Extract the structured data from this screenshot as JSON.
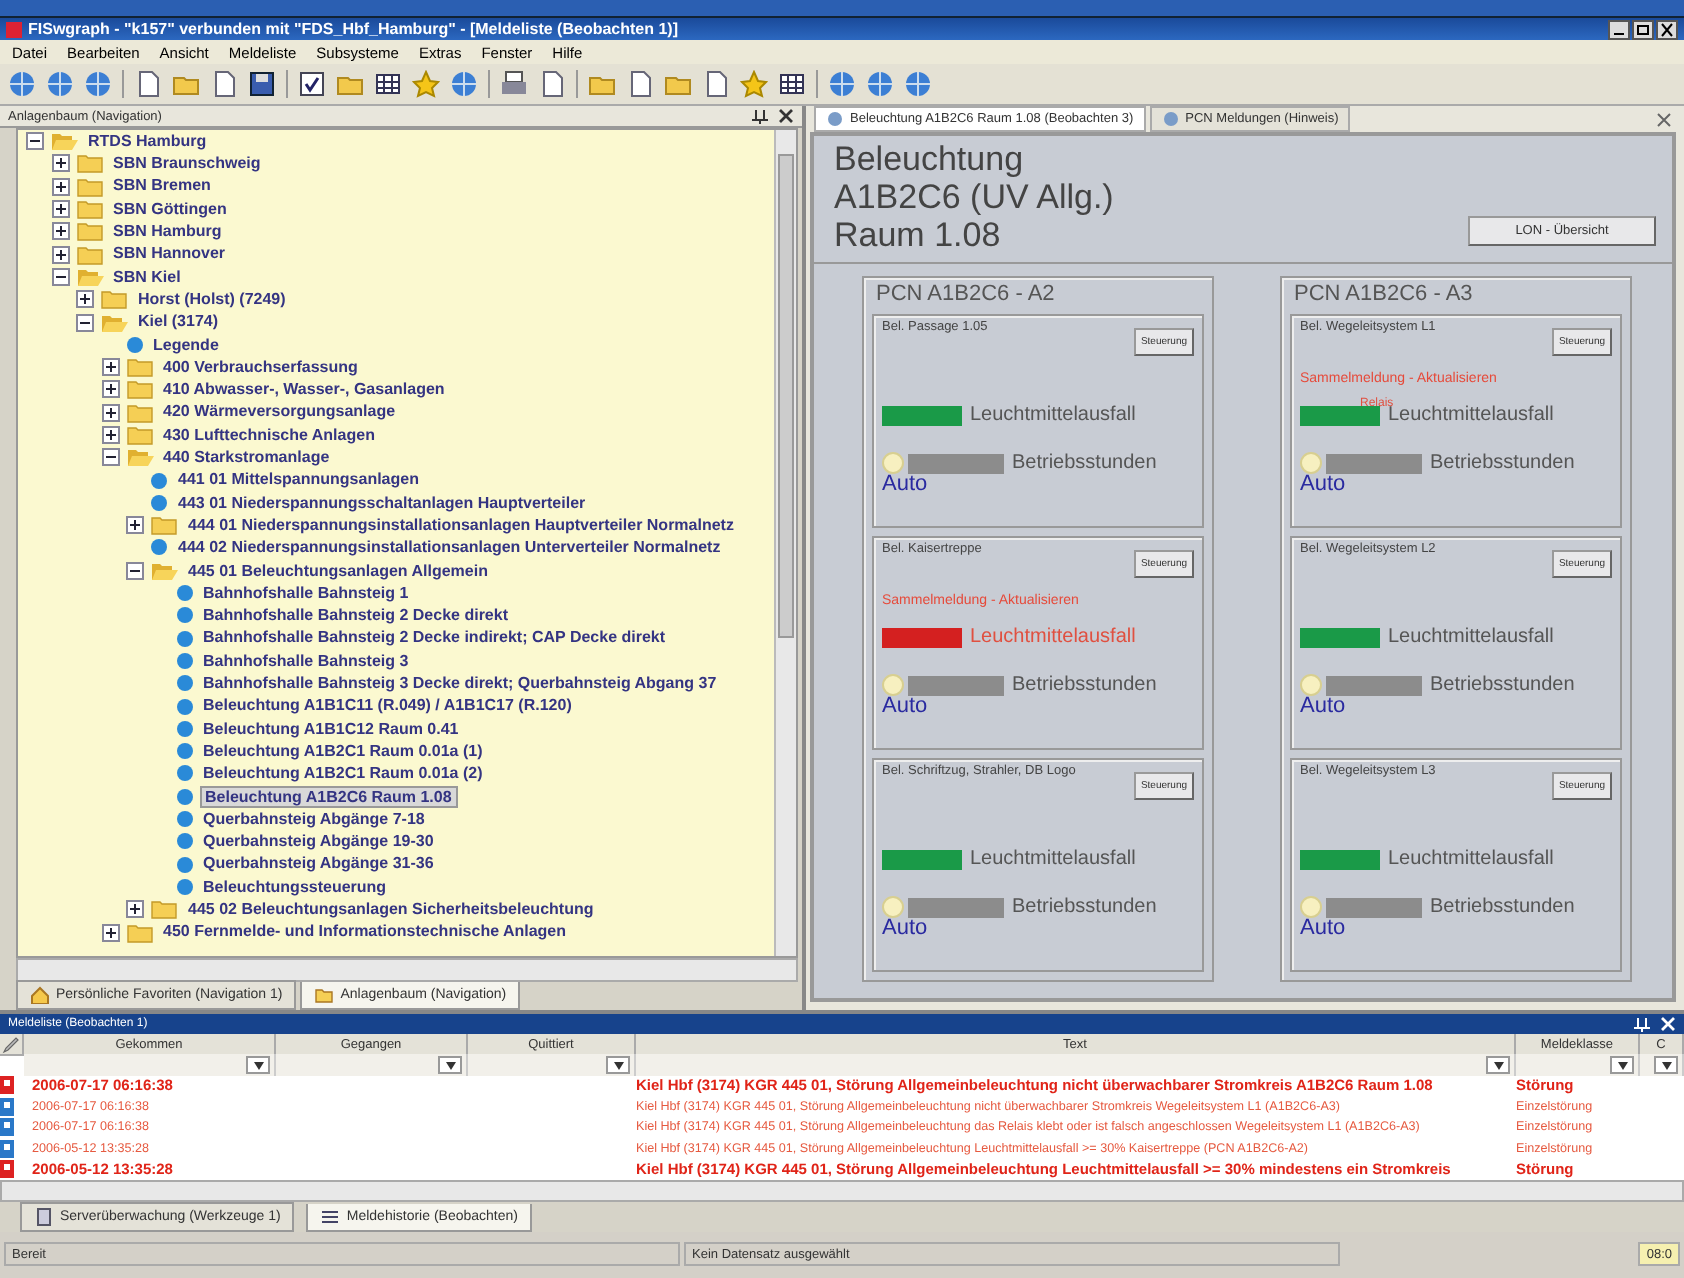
{
  "window": {
    "title": "FISwgraph - \"k157\" verbunden mit \"FDS_Hbf_Hamburg\" - [Meldeliste (Beobachten 1)]"
  },
  "menu": [
    "Datei",
    "Bearbeiten",
    "Ansicht",
    "Meldeliste",
    "Subsysteme",
    "Extras",
    "Fenster",
    "Hilfe"
  ],
  "tree_panel": {
    "title": "Anlagenbaum (Navigation)",
    "tree": [
      {
        "label": "RTDS Hamburg",
        "expanded": true,
        "selected": false,
        "children": [
          {
            "label": "SBN Braunschweig",
            "expanded": false,
            "selected": false
          },
          {
            "label": "SBN Bremen",
            "expanded": false,
            "selected": false
          },
          {
            "label": "SBN Göttingen",
            "expanded": false,
            "selected": false
          },
          {
            "label": "SBN Hamburg",
            "expanded": false,
            "selected": false
          },
          {
            "label": "SBN Hannover",
            "expanded": false,
            "selected": false
          },
          {
            "label": "SBN Kiel",
            "expanded": true,
            "selected": false,
            "children": [
              {
                "label": "Horst (Holst) (7249)",
                "expanded": false,
                "selected": false
              },
              {
                "label": "Kiel (3174)",
                "expanded": true,
                "selected": false,
                "children": [
                  {
                    "label": "Legende",
                    "selected": false
                  },
                  {
                    "label": "400 Verbrauchserfassung",
                    "expanded": false,
                    "selected": false
                  },
                  {
                    "label": "410 Abwasser-, Wasser-, Gasanlagen",
                    "expanded": false,
                    "selected": false
                  },
                  {
                    "label": "420 Wärmeversorgungsanlage",
                    "expanded": false,
                    "selected": false
                  },
                  {
                    "label": "430 Lufttechnische Anlagen",
                    "expanded": false,
                    "selected": false
                  },
                  {
                    "label": "440 Starkstromanlage",
                    "expanded": true,
                    "selected": false,
                    "children": [
                      {
                        "label": "441 01 Mittelspannungsanlagen",
                        "selected": false
                      },
                      {
                        "label": "443 01 Niederspannungsschaltanlagen Hauptverteiler",
                        "selected": false
                      },
                      {
                        "label": "444 01 Niederspannungsinstallationsanlagen Hauptverteiler Normalnetz",
                        "expanded": false,
                        "selected": false
                      },
                      {
                        "label": "444 02 Niederspannungsinstallationsanlagen Unterverteiler Normalnetz",
                        "selected": false
                      },
                      {
                        "label": "445 01 Beleuchtungsanlagen Allgemein",
                        "expanded": true,
                        "selected": false,
                        "children": [
                          {
                            "label": "Bahnhofshalle Bahnsteig 1",
                            "selected": false
                          },
                          {
                            "label": "Bahnhofshalle Bahnsteig 2 Decke direkt",
                            "selected": false
                          },
                          {
                            "label": "Bahnhofshalle Bahnsteig 2 Decke indirekt; CAP Decke direkt",
                            "selected": false
                          },
                          {
                            "label": "Bahnhofshalle Bahnsteig 3",
                            "selected": false
                          },
                          {
                            "label": "Bahnhofshalle Bahnsteig 3 Decke direkt; Querbahnsteig Abgang 37",
                            "selected": false
                          },
                          {
                            "label": "Beleuchtung A1B1C11 (R.049) / A1B1C17 (R.120)",
                            "selected": false
                          },
                          {
                            "label": "Beleuchtung A1B1C12 Raum 0.41",
                            "selected": false
                          },
                          {
                            "label": "Beleuchtung A1B2C1 Raum 0.01a (1)",
                            "selected": false
                          },
                          {
                            "label": "Beleuchtung A1B2C1 Raum 0.01a (2)",
                            "selected": false
                          },
                          {
                            "label": "Beleuchtung A1B2C6 Raum 1.08",
                            "selected": true
                          },
                          {
                            "label": "Querbahnsteig Abgänge  7-18",
                            "selected": false
                          },
                          {
                            "label": "Querbahnsteig Abgänge 19-30",
                            "selected": false
                          },
                          {
                            "label": "Querbahnsteig Abgänge 31-36",
                            "selected": false
                          },
                          {
                            "label": "Beleuchtungssteuerung",
                            "selected": false
                          }
                        ]
                      },
                      {
                        "label": "445 02 Beleuchtungsanlagen Sicherheitsbeleuchtung",
                        "expanded": false,
                        "selected": false
                      }
                    ]
                  },
                  {
                    "label": "450 Fernmelde- und Informationstechnische Anlagen",
                    "expanded": false,
                    "selected": false
                  }
                ]
              }
            ]
          }
        ]
      }
    ],
    "tabs": [
      {
        "label": "Persönliche Favoriten (Navigation 1)",
        "selected": false
      },
      {
        "label": "Anlagenbaum (Navigation)",
        "selected": true
      }
    ]
  },
  "detail_panel": {
    "tabs": [
      {
        "label": "Beleuchtung A1B2C6 Raum 1.08 (Beobachten 3)",
        "selected": true
      },
      {
        "label": "PCN Meldungen (Hinweis)",
        "selected": false
      }
    ],
    "heading": [
      "Beleuchtung",
      "A1B2C6 (UV Allg.)",
      "Raum 1.08"
    ],
    "overview_button": "LON - Übersicht",
    "groups": [
      {
        "title": "PCN A1B2C6 - A2",
        "circuits": [
          {
            "title": "Bel. Passage 1.05",
            "control_button": "Steuerung",
            "kind": "ok",
            "status_label": "Leuchtmittelausfall",
            "hours_label": "Betriebsstunden",
            "mode": "Auto"
          },
          {
            "title": "Bel. Kaisertreppe",
            "control_button": "Steuerung",
            "alarm": "Sammelmeldung - Aktualisieren",
            "kind": "fault",
            "status_label": "Leuchtmittelausfall",
            "hours_label": "Betriebsstunden",
            "mode": "Auto"
          },
          {
            "title": "Bel. Schriftzug, Strahler, DB Logo",
            "control_button": "Steuerung",
            "kind": "ok",
            "status_label": "Leuchtmittelausfall",
            "hours_label": "Betriebsstunden",
            "mode": "Auto"
          }
        ]
      },
      {
        "title": "PCN A1B2C6 - A3",
        "circuits": [
          {
            "title": "Bel. Wegeleitsystem L1",
            "control_button": "Steuerung",
            "alarm": "Sammelmeldung - Aktualisieren",
            "relay": "Relais",
            "kind": "ok",
            "status_label": "Leuchtmittelausfall",
            "hours_label": "Betriebsstunden",
            "mode": "Auto"
          },
          {
            "title": "Bel. Wegeleitsystem L2",
            "control_button": "Steuerung",
            "kind": "ok",
            "status_label": "Leuchtmittelausfall",
            "hours_label": "Betriebsstunden",
            "mode": "Auto"
          },
          {
            "title": "Bel. Wegeleitsystem L3",
            "control_button": "Steuerung",
            "kind": "ok",
            "status_label": "Leuchtmittelausfall",
            "hours_label": "Betriebsstunden",
            "mode": "Auto"
          }
        ]
      }
    ]
  },
  "message_list": {
    "title": "Meldeliste (Beobachten 1)",
    "columns": [
      "Gekommen",
      "Gegangen",
      "Quittiert",
      "Text",
      "Meldeklasse",
      "C"
    ],
    "rows": [
      {
        "kind": "alarm",
        "came": "2006-07-17 06:16:38",
        "text": "Kiel Hbf (3174) KGR 445 01, Störung Allgemeinbeleuchtung nicht überwachbarer Stromkreis A1B2C6 Raum 1.08",
        "class": "Störung"
      },
      {
        "kind": "detail",
        "came": "2006-07-17 06:16:38",
        "text": "Kiel Hbf (3174) KGR 445 01, Störung Allgemeinbeleuchtung nicht überwachbarer Stromkreis Wegeleitsystem L1 (A1B2C6-A3)",
        "class": "Einzelstörung"
      },
      {
        "kind": "detail",
        "came": "2006-07-17 06:16:38",
        "text": "Kiel Hbf (3174) KGR 445 01, Störung Allgemeinbeleuchtung das Relais klebt oder ist falsch angeschlossen Wegeleitsystem L1 (A1B2C6-A3)",
        "class": "Einzelstörung"
      },
      {
        "kind": "detail",
        "came": "2006-05-12 13:35:28",
        "text": "Kiel Hbf (3174) KGR 445 01, Störung Allgemeinbeleuchtung Leuchtmittelausfall >= 30% Kaisertreppe (PCN A1B2C6-A2)",
        "class": "Einzelstörung"
      },
      {
        "kind": "alarm",
        "came": "2006-05-12 13:35:28",
        "text": "Kiel Hbf (3174) KGR 445 01, Störung Allgemeinbeleuchtung Leuchtmittelausfall >= 30% mindestens ein Stromkreis",
        "class": "Störung"
      }
    ]
  },
  "bottom_tabs": [
    {
      "label": "Serverüberwachung (Werkzeuge 1)",
      "selected": false
    },
    {
      "label": "Meldehistorie (Beobachten)",
      "selected": true
    }
  ],
  "status_bar": [
    "Bereit",
    "Kein Datensatz ausgewählt",
    "08:0"
  ]
}
